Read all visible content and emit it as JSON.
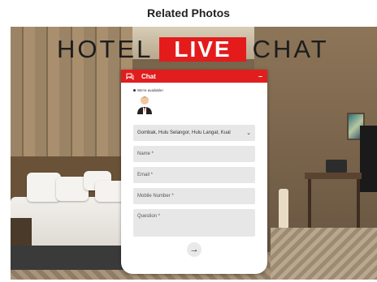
{
  "page": {
    "title": "Related Photos"
  },
  "banner": {
    "word_left": "HOTEL",
    "word_live": "LIVE",
    "word_right": "CHAT"
  },
  "chat": {
    "header_title": "Chat",
    "minimize_label": "–",
    "availability": "We're available!",
    "location_select": "Gombak, Hulu Selangor, Hulu Langat, Kual",
    "name_placeholder": "Name *",
    "email_placeholder": "Email *",
    "mobile_placeholder": "Mobile Number *",
    "question_placeholder": "Question *",
    "send_label": "→"
  },
  "colors": {
    "accent": "#e01e1e",
    "field_bg": "#e7e7e7"
  }
}
